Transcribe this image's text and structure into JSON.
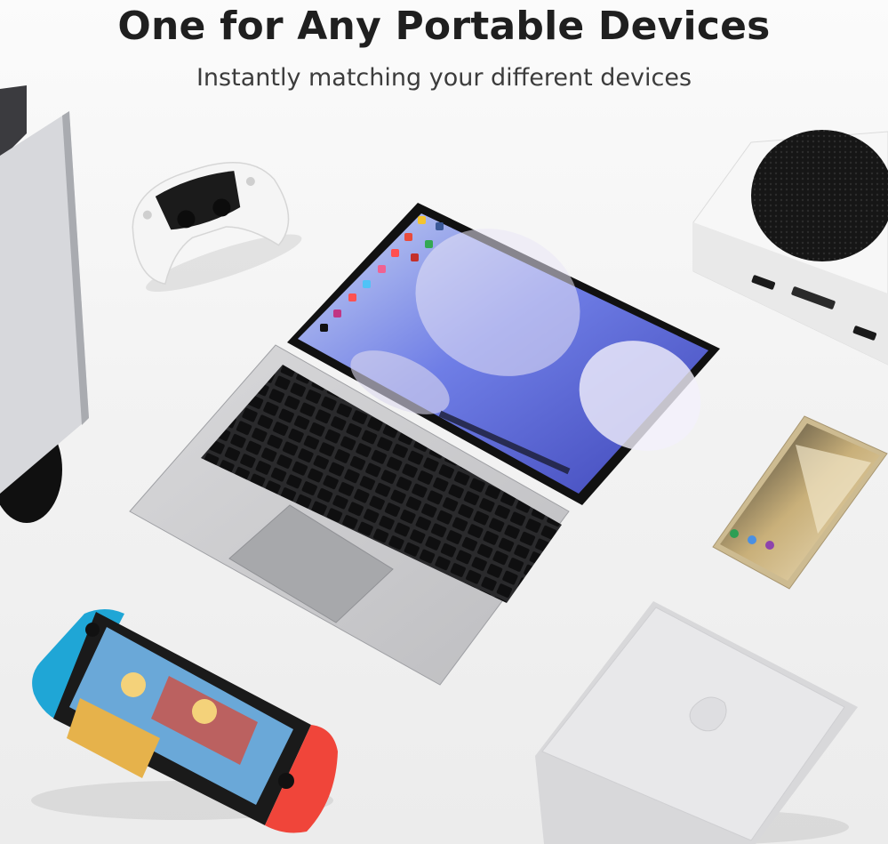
{
  "header": {
    "title": "One for Any Portable Devices",
    "subtitle": "Instantly matching your different devices"
  },
  "devices": [
    "game-console-tower",
    "gamepad-controller",
    "portable-monitor-keyboard",
    "game-console-box",
    "smartphone",
    "handheld-game-console",
    "mini-desktop-computer"
  ],
  "colors": {
    "headline": "#1f1f1f",
    "subline": "#3c3c3c",
    "background": "#f3f3f3",
    "screen_wallpaper": "#6f7ee6",
    "joycon_left": "#1fa6d6",
    "joycon_right": "#f0453a"
  }
}
